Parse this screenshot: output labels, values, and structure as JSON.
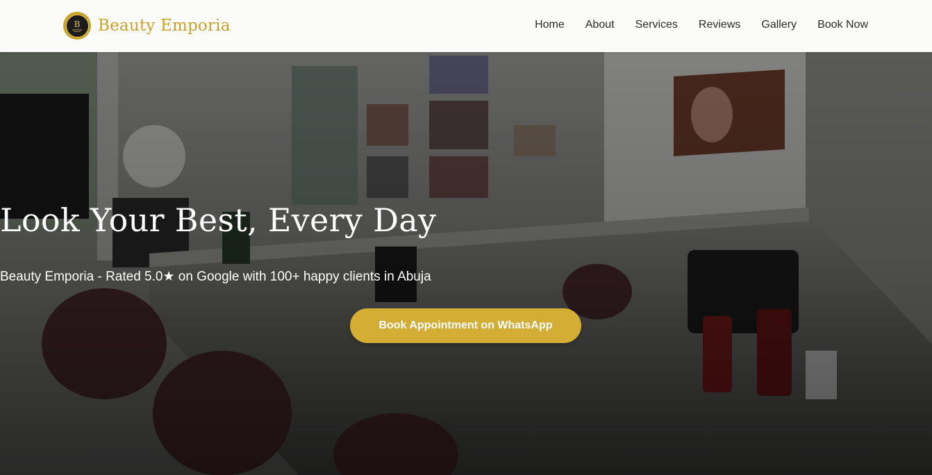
{
  "brand": {
    "name": "Beauty Emporia",
    "logo_icon": "beauty-emporia-monogram-logo",
    "accent_color": "#c9a227"
  },
  "nav": {
    "items": [
      {
        "label": "Home"
      },
      {
        "label": "About"
      },
      {
        "label": "Services"
      },
      {
        "label": "Reviews"
      },
      {
        "label": "Gallery"
      },
      {
        "label": "Book Now"
      }
    ]
  },
  "hero": {
    "title": "Look Your Best, Every Day",
    "subtitle": "Beauty Emporia - Rated 5.0★ on Google with 100+ happy clients in Abuja",
    "cta_label": "Book Appointment on WhatsApp",
    "cta_color": "#d4ad34",
    "background": "salon-interior-photo"
  }
}
